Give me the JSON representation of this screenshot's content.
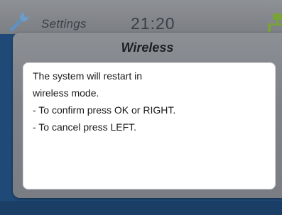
{
  "status_bar": {
    "title": "Settings",
    "time": "21:20",
    "left_icon": "wrench-icon",
    "right_icon": "network-icon"
  },
  "dialog": {
    "title": "Wireless",
    "lines": [
      "The system will restart in",
      "wireless mode.",
      "- To confirm press OK or RIGHT.",
      "- To cancel press LEFT."
    ]
  },
  "colors": {
    "status_bar": "#84878c",
    "dialog_frame": "#7f8389",
    "dialog_body": "#ffffff",
    "background": "#1f4a78",
    "network_icon": "#7aa23a"
  }
}
